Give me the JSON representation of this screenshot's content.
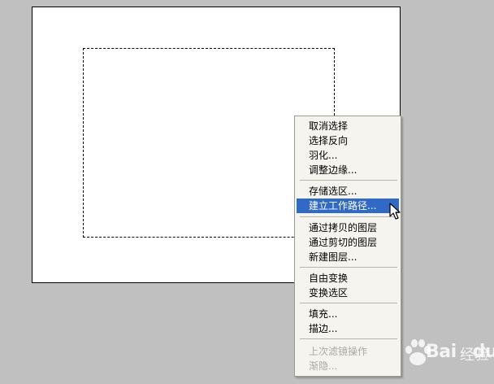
{
  "menu": {
    "items": [
      {
        "label": "取消选择"
      },
      {
        "label": "选择反向"
      },
      {
        "label": "羽化..."
      },
      {
        "label": "调整边缘..."
      },
      {
        "label": "存储选区..."
      },
      {
        "label": "建立工作路径..."
      },
      {
        "label": "通过拷贝的图层"
      },
      {
        "label": "通过剪切的图层"
      },
      {
        "label": "新建图层..."
      },
      {
        "label": "自由变换"
      },
      {
        "label": "变换选区"
      },
      {
        "label": "填充..."
      },
      {
        "label": "描边..."
      },
      {
        "label": "上次滤镜操作"
      },
      {
        "label": "渐隐..."
      }
    ],
    "highlighted_index": 5,
    "disabled_indices": [
      13,
      14
    ]
  },
  "colors": {
    "highlight": "#316ac5",
    "menu_bg": "#f5f4ee",
    "background": "#c0c0c0",
    "canvas": "#ffffff"
  },
  "icons": {
    "cursor": "arrow-cursor-icon",
    "watermark": "baidu-paw-logo"
  },
  "watermark": {
    "text_bai": "Bai",
    "text_du": "du",
    "text_sub": "经验"
  }
}
